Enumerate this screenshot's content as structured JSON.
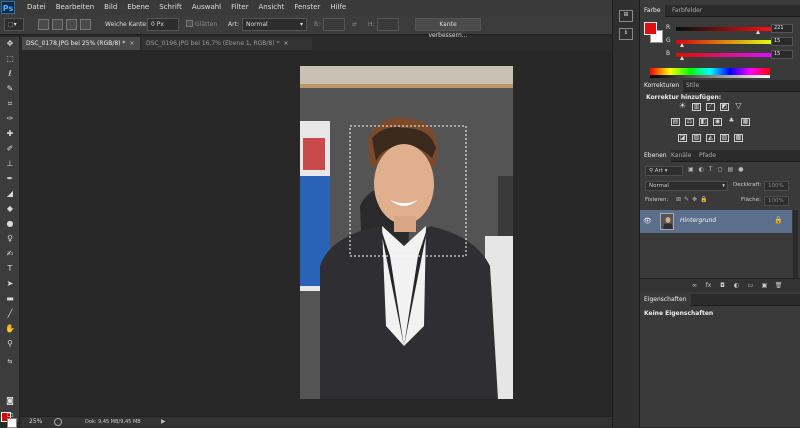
{
  "app": {
    "logo": "Ps"
  },
  "menu": [
    "Datei",
    "Bearbeiten",
    "Bild",
    "Ebene",
    "Schrift",
    "Auswahl",
    "Filter",
    "Ansicht",
    "Fenster",
    "Hilfe"
  ],
  "window_controls": {
    "minimize": "–",
    "maximize": "□",
    "close": "×"
  },
  "options": {
    "feather_label": "Weiche Kante:",
    "feather_value": "0 Px",
    "antialias_label": "Glätten",
    "style_label": "Art:",
    "style_value": "Normal",
    "width_label": "B:",
    "height_label": "H:",
    "refine_button": "Kante verbessern..."
  },
  "doc_tabs": [
    {
      "label": "DSC_0178.JPG bei 25% (RGB/8) *",
      "close": "×"
    },
    {
      "label": "DSC_0196.JPG bei 16,7% (Ebene 1, RGB/8) *",
      "close": "×"
    }
  ],
  "status": {
    "zoom": "25%",
    "doc_size": "Dok: 9,45 MB/9,45 MB",
    "arrow": "▶"
  },
  "color_panel": {
    "tabs": [
      "Farbe",
      "Farbfelder"
    ],
    "channels": [
      {
        "label": "R",
        "value": "221",
        "fraction": 0.867,
        "bar": "linear-gradient(90deg,#000f0f,#ff0f0f)"
      },
      {
        "label": "G",
        "value": "15",
        "fraction": 0.059,
        "bar": "linear-gradient(90deg,#dd000f,#ddff0f)"
      },
      {
        "label": "B",
        "value": "15",
        "fraction": 0.059,
        "bar": "linear-gradient(90deg,#dd0f00,#dd0fff)"
      }
    ],
    "foreground": "#dd0f0f"
  },
  "adjust_panel": {
    "tabs": [
      "Korrekturen",
      "Stile"
    ],
    "heading": "Korrektur hinzufügen:"
  },
  "layers_panel": {
    "tabs": [
      "Ebenen",
      "Kanäle",
      "Pfade"
    ],
    "filter_label": "Art",
    "blend_mode": "Normal",
    "opacity_label": "Deckkraft:",
    "opacity_value": "100%",
    "lock_label": "Fixieren:",
    "fill_label": "Fläche:",
    "fill_value": "100%",
    "layer_name": "Hintergrund",
    "bottom_icons": [
      "∞",
      "fx",
      "◘",
      "◐",
      "▭",
      "▣",
      "🗑"
    ]
  },
  "props_panel": {
    "tab": "Eigenschaften",
    "empty_label": "Keine Eigenschaften"
  }
}
